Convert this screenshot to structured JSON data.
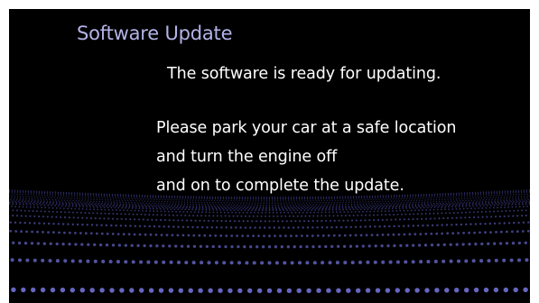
{
  "screen": {
    "title": "Software Update",
    "headline": "The software is ready for updating.",
    "instructions": [
      "Please park your car at a safe location",
      "and turn the engine off",
      "and on to complete the update."
    ]
  },
  "colors": {
    "background": "#000000",
    "title": "#b3b3e8",
    "text": "#ffffff",
    "grid_dot_far": "#1c1c48",
    "grid_dot_near": "#6f6fcf"
  },
  "icons": {
    "background": "dotted-perspective-grid"
  }
}
